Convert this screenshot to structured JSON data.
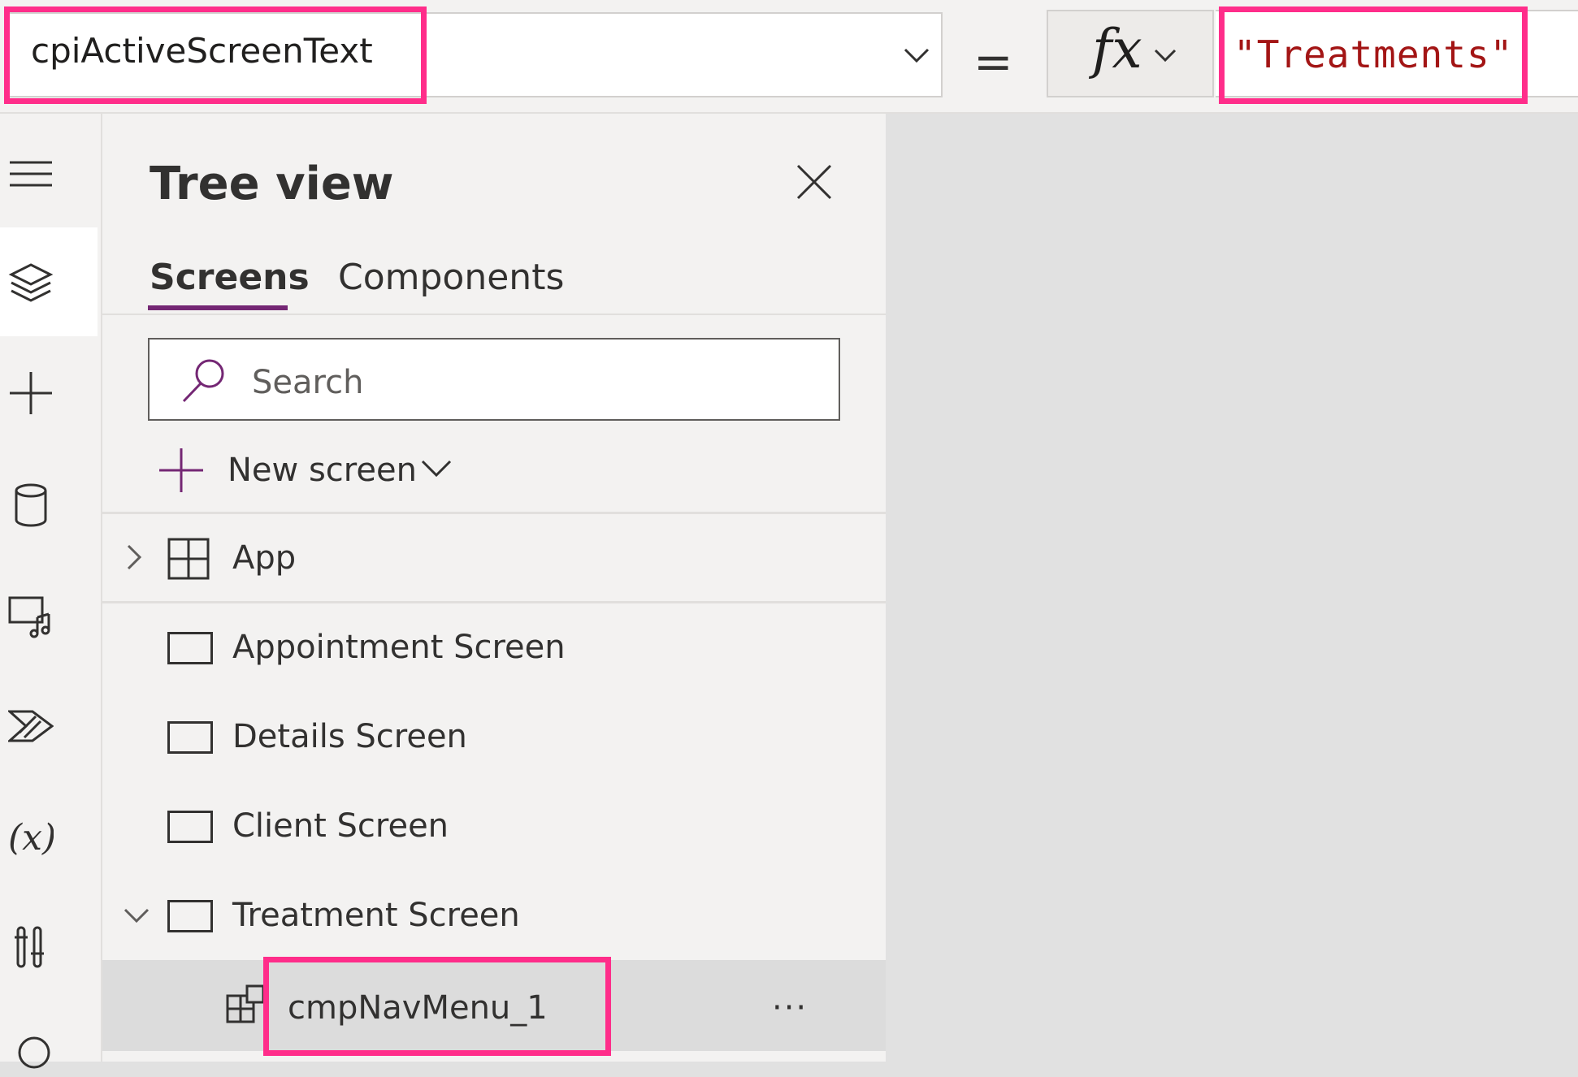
{
  "formula_bar": {
    "property": "cpiActiveScreenText",
    "equals": "=",
    "fx_label": "fx",
    "formula": "\"Treatments\""
  },
  "tree_view": {
    "title": "Tree view",
    "tabs": [
      {
        "label": "Screens",
        "active": true
      },
      {
        "label": "Components",
        "active": false
      }
    ],
    "search_placeholder": "Search",
    "new_screen_label": "New screen",
    "items": [
      {
        "label": "App",
        "icon": "app-icon",
        "expandable": true,
        "expanded": false
      },
      {
        "label": "Appointment Screen",
        "icon": "screen-icon"
      },
      {
        "label": "Details Screen",
        "icon": "screen-icon"
      },
      {
        "label": "Client Screen",
        "icon": "screen-icon"
      },
      {
        "label": "Treatment Screen",
        "icon": "screen-icon",
        "expandable": true,
        "expanded": true
      },
      {
        "label": "cmpNavMenu_1",
        "icon": "component-icon",
        "selected": true
      }
    ],
    "more_label": "···"
  },
  "colors": {
    "accent": "#742774",
    "highlight": "#ff2d8a",
    "formula_string": "#a31515"
  },
  "rail_icons": [
    "hamburger-menu-icon",
    "layers-icon",
    "insert-plus-icon",
    "data-cylinder-icon",
    "media-icon",
    "power-automate-icon",
    "variables-icon",
    "advanced-tools-icon",
    "search-icon"
  ]
}
